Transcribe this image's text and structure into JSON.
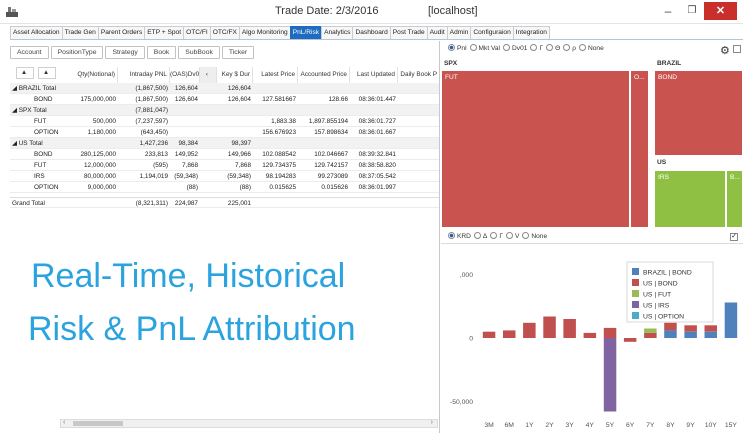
{
  "window": {
    "title_trade_date": "Trade Date: 2/3/2016",
    "title_server": "[localhost]",
    "minimize": "–",
    "maximize": "❐",
    "close": "✕"
  },
  "tabs": [
    {
      "label": "Asset Allocation",
      "active": false
    },
    {
      "label": "Trade Gen",
      "active": false
    },
    {
      "label": "Parent Orders",
      "active": false
    },
    {
      "label": "ETP + Spot",
      "active": false
    },
    {
      "label": "OTC/FI",
      "active": false
    },
    {
      "label": "OTC/FX",
      "active": false
    },
    {
      "label": "Algo Monitoring",
      "active": false
    },
    {
      "label": "PnL/Risk",
      "active": true
    },
    {
      "label": "Analytics",
      "active": false
    },
    {
      "label": "Dashboard",
      "active": false
    },
    {
      "label": "Post Trade",
      "active": false
    },
    {
      "label": "Audit",
      "active": false
    },
    {
      "label": "Admin",
      "active": false
    },
    {
      "label": "Configuraion",
      "active": false
    },
    {
      "label": "Integration",
      "active": false
    }
  ],
  "filters": [
    "Account",
    "PositionType",
    "Strategy",
    "Book",
    "SubBook",
    "Ticker"
  ],
  "grid": {
    "sort_glyphs": [
      "▲",
      "▲"
    ],
    "headers": [
      "Qty(Notional)",
      "Intraday PNL",
      "(OAS)Dv01",
      "‹",
      "Key $ Dur",
      "Latest Price",
      "Accounted Price",
      "Last Updated",
      "Daily Book P"
    ],
    "rows": [
      {
        "type": "group",
        "label": "◢ BRAZIL Total",
        "cells": [
          "",
          "(1,867,500)",
          "126,604",
          "",
          "126,604",
          "",
          "",
          "",
          ""
        ]
      },
      {
        "type": "item",
        "label": "BOND",
        "cells": [
          "175,000,000",
          "(1,867,500)",
          "126,604",
          "",
          "126,604",
          "127.581667",
          "128.66",
          "08:36:01.447",
          ""
        ]
      },
      {
        "type": "group",
        "label": "◢ SPX Total",
        "cells": [
          "",
          "(7,881,047)",
          "",
          "",
          "",
          "",
          "",
          "",
          ""
        ]
      },
      {
        "type": "item",
        "label": "FUT",
        "cells": [
          "500,000",
          "(7,237,597)",
          "",
          "",
          "",
          "1,883.38",
          "1,897.855194",
          "08:36:01.727",
          ""
        ]
      },
      {
        "type": "item",
        "label": "OPTION",
        "cells": [
          "1,180,000",
          "(643,450)",
          "",
          "",
          "",
          "156.676923",
          "157.898634",
          "08:36:01.667",
          ""
        ]
      },
      {
        "type": "group",
        "label": "◢ US Total",
        "cells": [
          "",
          "1,427,236",
          "98,384",
          "",
          "98,397",
          "",
          "",
          "",
          ""
        ]
      },
      {
        "type": "item",
        "label": "BOND",
        "cells": [
          "280,125,000",
          "233,813",
          "149,952",
          "",
          "149,966",
          "102.088542",
          "102.046667",
          "08:39:32.841",
          ""
        ]
      },
      {
        "type": "item",
        "label": "FUT",
        "cells": [
          "12,000,000",
          "(595)",
          "7,868",
          "",
          "7,868",
          "129.734375",
          "129.742157",
          "08:38:58.820",
          ""
        ]
      },
      {
        "type": "item",
        "label": "IRS",
        "cells": [
          "80,000,000",
          "1,194,019",
          "(59,348)",
          "",
          "(59,348)",
          "98.194283",
          "99.273089",
          "08:37:05.542",
          ""
        ]
      },
      {
        "type": "item",
        "label": "OPTION",
        "cells": [
          "9,000,000",
          "",
          "(88)",
          "",
          "(88)",
          "0.015625",
          "0.015626",
          "08:36:01.997",
          ""
        ]
      },
      {
        "type": "grand",
        "label": "Grand Total",
        "cells": [
          "",
          "(8,321,311)",
          "224,987",
          "",
          "225,001",
          "",
          "",
          "",
          ""
        ]
      }
    ]
  },
  "scroll": {
    "left": "‹",
    "right": "›"
  },
  "overlay": {
    "line1": "Real-Time, Historical",
    "line2": "Risk & PnL Attribution"
  },
  "treemap_controls": {
    "options": [
      {
        "label": "Pnl",
        "on": true
      },
      {
        "label": "Mkt Val",
        "on": false
      },
      {
        "label": "Dv01",
        "on": false
      },
      {
        "label": "Γ",
        "on": false
      },
      {
        "label": "Θ",
        "on": false
      },
      {
        "label": "ρ",
        "on": false
      },
      {
        "label": "None",
        "on": false
      }
    ],
    "gear": "⚙"
  },
  "treemap": {
    "red": "#c9534f",
    "green": "#8fc043",
    "groups": {
      "spx": {
        "title": "SPX",
        "fut": "FUT",
        "option": "O..."
      },
      "brazil": {
        "title": "BRAZIL",
        "bond": "BOND"
      },
      "us": {
        "title": "US",
        "irs": "IRS",
        "b": "B..."
      }
    }
  },
  "chart_controls": {
    "options": [
      {
        "label": "KRD",
        "on": true
      },
      {
        "label": "Δ",
        "on": false
      },
      {
        "label": "Γ",
        "on": false
      },
      {
        "label": "V",
        "on": false
      },
      {
        "label": "None",
        "on": false
      }
    ],
    "check": "✓"
  },
  "chart_data": {
    "type": "bar",
    "stacked": true,
    "categories": [
      "3M",
      "6M",
      "1Y",
      "2Y",
      "3Y",
      "4Y",
      "5Y",
      "6Y",
      "7Y",
      "8Y",
      "9Y",
      "10Y",
      "15Y"
    ],
    "ytick_labels": [
      ",000",
      "0",
      "-50,000"
    ],
    "ytick_values": [
      50000,
      0,
      -50000
    ],
    "ylim": [
      -60000,
      60000
    ],
    "legend_position": "top-right",
    "series": [
      {
        "name": "BRAZIL | BOND",
        "color": "#4f81bd",
        "values": [
          0,
          0,
          0,
          0,
          0,
          0,
          0,
          0,
          0,
          6000,
          5000,
          5000,
          28000
        ]
      },
      {
        "name": "US | BOND",
        "color": "#c0504d",
        "values": [
          5000,
          6000,
          12000,
          17000,
          15000,
          4000,
          8000,
          -3000,
          4000,
          6000,
          5000,
          5000,
          0
        ]
      },
      {
        "name": "US | FUT",
        "color": "#9bbb59",
        "values": [
          0,
          0,
          0,
          0,
          0,
          0,
          0,
          0,
          3500,
          0,
          0,
          0,
          0
        ]
      },
      {
        "name": "US | IRS",
        "color": "#8064a2",
        "values": [
          0,
          0,
          0,
          0,
          0,
          0,
          -58000,
          0,
          0,
          0,
          0,
          0,
          0
        ]
      },
      {
        "name": "US | OPTION",
        "color": "#4bacc6",
        "values": [
          0,
          0,
          0,
          0,
          0,
          0,
          0,
          0,
          0,
          0,
          0,
          0,
          0
        ]
      }
    ],
    "xlabel": "",
    "ylabel": ""
  }
}
